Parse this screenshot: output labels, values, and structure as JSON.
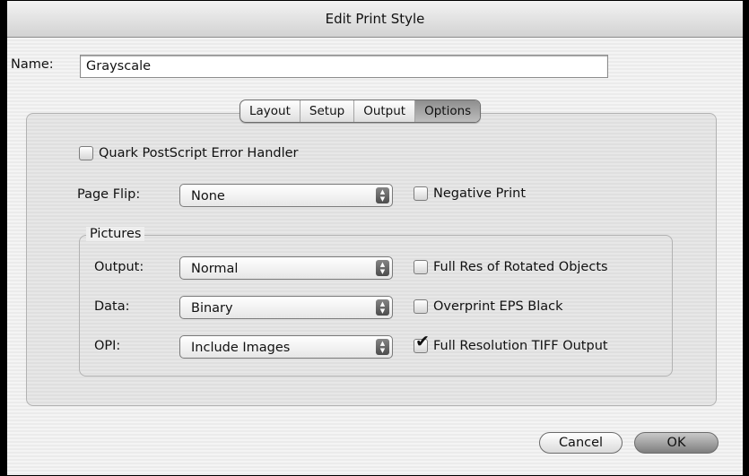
{
  "window": {
    "title": "Edit Print Style"
  },
  "name": {
    "label": "Name:",
    "value": "Grayscale"
  },
  "tabs": [
    {
      "label": "Layout",
      "selected": false
    },
    {
      "label": "Setup",
      "selected": false
    },
    {
      "label": "Output",
      "selected": false
    },
    {
      "label": "Options",
      "selected": true
    }
  ],
  "options": {
    "error_handler": {
      "label": "Quark PostScript Error Handler",
      "checked": false
    },
    "page_flip": {
      "label": "Page Flip:",
      "value": "None"
    },
    "negative_print": {
      "label": "Negative Print",
      "checked": false
    }
  },
  "pictures": {
    "title": "Pictures",
    "output": {
      "label": "Output:",
      "value": "Normal"
    },
    "data": {
      "label": "Data:",
      "value": "Binary"
    },
    "opi": {
      "label": "OPI:",
      "value": "Include Images"
    },
    "full_res_rotated": {
      "label": "Full Res of Rotated Objects",
      "checked": false
    },
    "overprint_eps": {
      "label": "Overprint EPS Black",
      "checked": false
    },
    "full_res_tiff": {
      "label": "Full Resolution TIFF Output",
      "checked": true
    }
  },
  "buttons": {
    "cancel": "Cancel",
    "ok": "OK"
  },
  "icons": {
    "check": "✔",
    "popup_up": "▲",
    "popup_down": "▼"
  }
}
